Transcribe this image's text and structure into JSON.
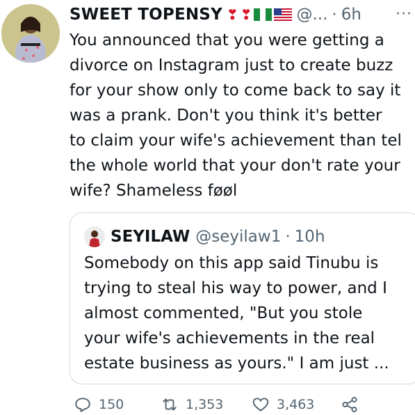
{
  "author": {
    "display_name": "SWEET TOPENSY",
    "handle": "@...",
    "separator": "·",
    "time": "6h",
    "more_label": "···"
  },
  "emojis": [
    "red-heart-exclamation",
    "red-heart-exclamation",
    "nigeria-flag",
    "usa-flag"
  ],
  "tweet": {
    "text": "You announced that you were getting a\ndivorce on Instagram just to create buzz\nfor your show only to come back to say it\nwas a prank. Don't you think it's better\nto claim your wife's achievement than tel\nthe whole world that your don't rate your\nwife? Shameless føøl"
  },
  "quoted": {
    "display_name": "SEYILAW",
    "handle": "@seyilaw1",
    "separator": "·",
    "time": "10h",
    "text": "Somebody on this app said Tinubu is\ntrying to steal his way to power, and I\nalmost commented, \"But you stole\nyour wife's achievements in the real\nestate business as yours.\" I am just ..."
  },
  "actions": {
    "replies": "150",
    "retweets": "1,353",
    "likes": "3,463"
  },
  "colors": {
    "secondary_text": "#536471",
    "border": "#cfd9de",
    "heart": "#d81b2b"
  }
}
